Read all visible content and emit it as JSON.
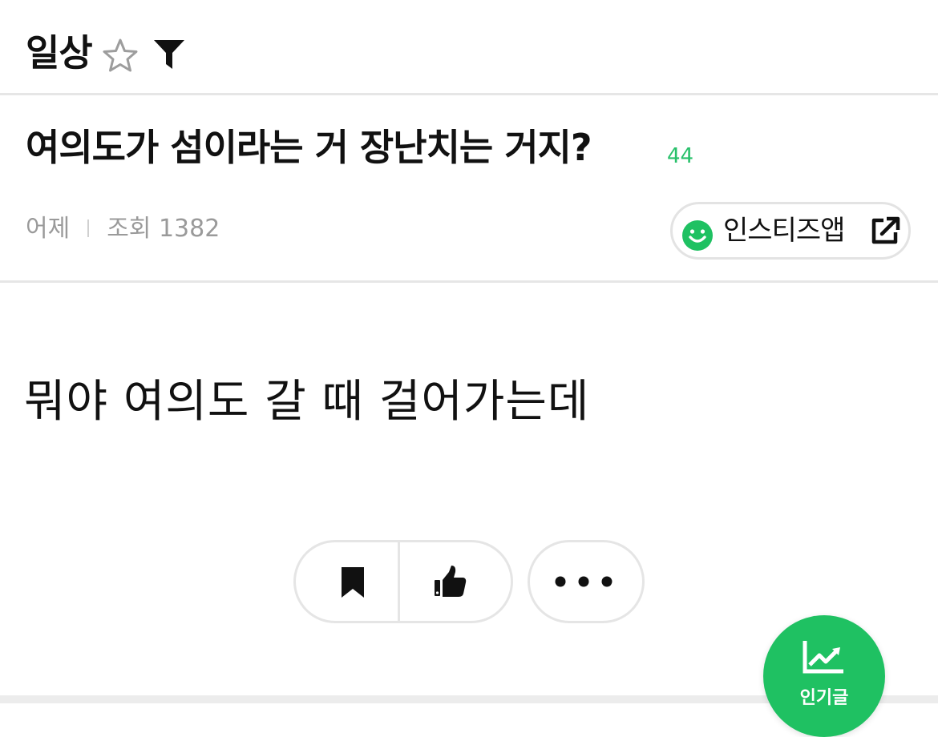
{
  "header": {
    "board_name": "일상"
  },
  "post": {
    "title": "여의도가 섬이라는 거 장난치는 거지?",
    "comment_count": "44",
    "date": "어제",
    "views_label": "조회 1382",
    "body": "뭐야 여의도 갈 때 걸어가는데"
  },
  "app_button": {
    "label": "인스티즈앱"
  },
  "fab": {
    "label": "인기글"
  },
  "colors": {
    "accent": "#1fc162",
    "comment": "#27c06a",
    "muted": "#9a9a9a"
  },
  "icons": [
    "star-icon",
    "filter-icon",
    "smile-icon",
    "external-link-icon",
    "bookmark-icon",
    "thumbs-up-icon",
    "more-icon",
    "trend-icon"
  ]
}
